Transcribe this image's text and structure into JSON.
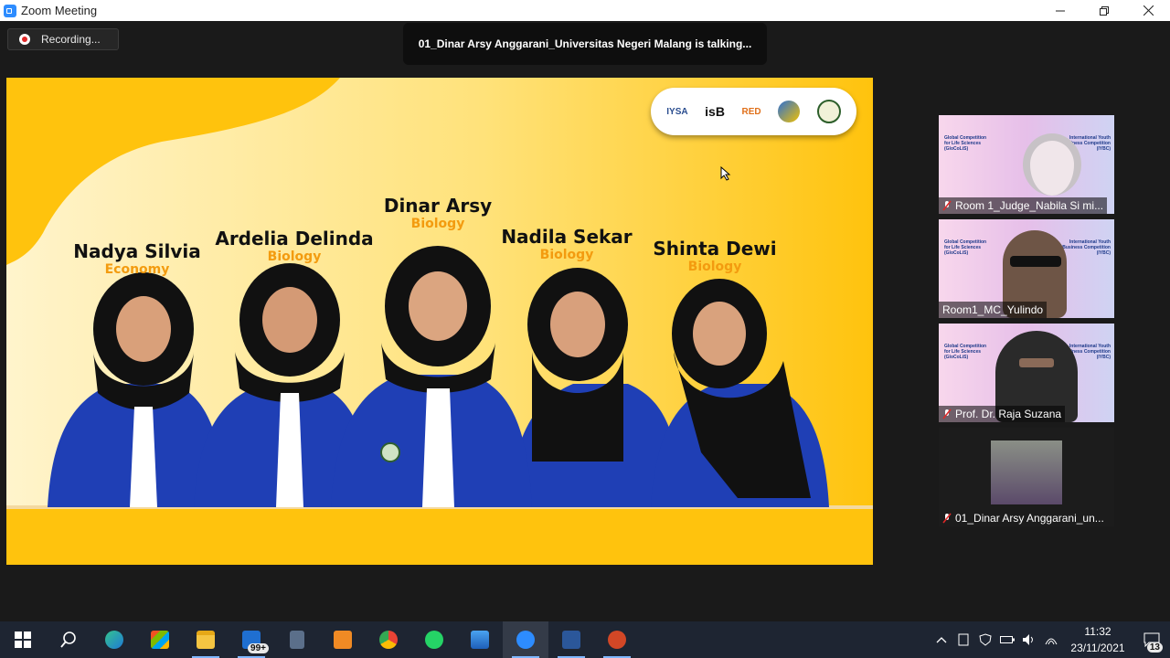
{
  "window": {
    "title": "Zoom Meeting",
    "minimize_icon": "minimize-icon",
    "restore_icon": "restore-icon",
    "close_icon": "close-icon"
  },
  "meeting": {
    "recording_label": "Recording...",
    "talking_banner": "01_Dinar Arsy Anggarani_Universitas Negeri Malang is talking..."
  },
  "slide": {
    "logos": [
      "IYSA",
      "isB",
      "RED"
    ],
    "people": [
      {
        "name": "Nadya Silvia",
        "major": "Economy"
      },
      {
        "name": "Ardelia Delinda",
        "major": "Biology"
      },
      {
        "name": "Dinar Arsy",
        "major": "Biology"
      },
      {
        "name": "Nadila Sekar",
        "major": "Biology"
      },
      {
        "name": "Shinta Dewi",
        "major": "Biology"
      }
    ]
  },
  "gallery": {
    "tile_left_text": [
      "Global Competition",
      "for Life Sciences",
      "(GloCoLiS)"
    ],
    "tile_right_text": [
      "International Youth",
      "Business Competition",
      "(IYBC)"
    ],
    "participants": [
      {
        "name": "Room 1_Judge_Nabila Si mi...",
        "muted": true
      },
      {
        "name": "Room1_MC_Yulindo",
        "muted": false
      },
      {
        "name": "Prof. Dr. Raja Suzana",
        "muted": true
      },
      {
        "name": "01_Dinar Arsy Anggarani_un...",
        "muted": true
      }
    ]
  },
  "taskbar": {
    "mail_badge": "99+",
    "time": "11:32",
    "date": "23/11/2021",
    "notification_count": "13",
    "apps": [
      "windows-start-icon",
      "search-icon",
      "edge-icon",
      "store-icon",
      "file-explorer-icon",
      "mail-icon",
      "calculator-icon",
      "media-player-icon",
      "chrome-icon",
      "whatsapp-icon",
      "photos-icon",
      "zoom-icon",
      "word-icon",
      "powerpoint-icon"
    ]
  }
}
